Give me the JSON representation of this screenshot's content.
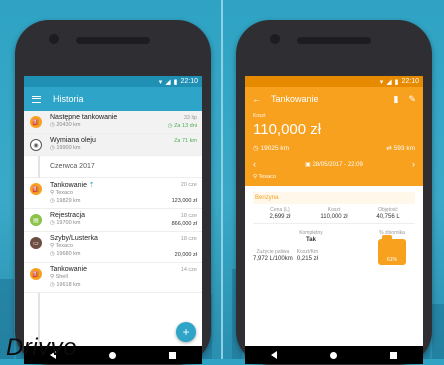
{
  "watermark": "Drivvo",
  "left": {
    "status_time": "22:10",
    "app_title": "Historia",
    "month_header": "Czerwca 2017",
    "items": [
      {
        "title": "Następne tankowanie",
        "sub1": "20430 km",
        "sub2": "",
        "right1": "33 lip",
        "right2": "Za 13 dni",
        "icon": "fuel-icon",
        "color": "#f7a11f"
      },
      {
        "title": "Wymiana oleju",
        "sub1": "19900 km",
        "sub2": "",
        "right1": "",
        "right2": "Za 71 km",
        "icon": "oil-icon",
        "color": "#555555"
      },
      {
        "title": "Tankowanie",
        "sub1": "Texaco",
        "sub2": "19829 km",
        "right1": "20 cze",
        "right2": "123,000 zł",
        "icon": "fuel-icon",
        "color": "#f7a11f"
      },
      {
        "title": "Rejestracja",
        "sub1": "19700 km",
        "sub2": "",
        "right1": "18 cze",
        "right2": "866,000 zł",
        "icon": "registration-icon",
        "color": "#8bc34a"
      },
      {
        "title": "Szyby/Lusterka",
        "sub1": "Texaco",
        "sub2": "19680 km",
        "right1": "18 cze",
        "right2": "20,000 zł",
        "icon": "car-icon",
        "color": "#6d4c41"
      },
      {
        "title": "Tankowanie",
        "sub1": "Shell",
        "sub2": "19618 km",
        "right1": "14 cze",
        "right2": "",
        "icon": "fuel-icon",
        "color": "#f7a11f"
      }
    ],
    "fab_label": "+"
  },
  "right": {
    "status_time": "22:10",
    "app_title": "Tankowanie",
    "cost_label": "Koszt",
    "cost_value": "110,000 zł",
    "odometer": "19025 km",
    "distance": "593 km",
    "date": "28/05/2017 - 22:09",
    "station": "Texaco",
    "fuel_type": "Benzyna",
    "fuel_cols": [
      {
        "label": "Cena (L)",
        "value": "2,699 zł"
      },
      {
        "label": "Koszt",
        "value": "110,000 zł"
      },
      {
        "label": "Objętość",
        "value": "40,756 L"
      }
    ],
    "full_label": "Kompletny",
    "full_value": "Tak",
    "tank_label": "% zbiornika",
    "tank_value": "61%",
    "consumption_label": "Zużycie paliwa",
    "consumption_value": "7,972 L/100km",
    "cost_km_label": "Koszt/Km",
    "cost_km_value": "0,215 zł"
  }
}
